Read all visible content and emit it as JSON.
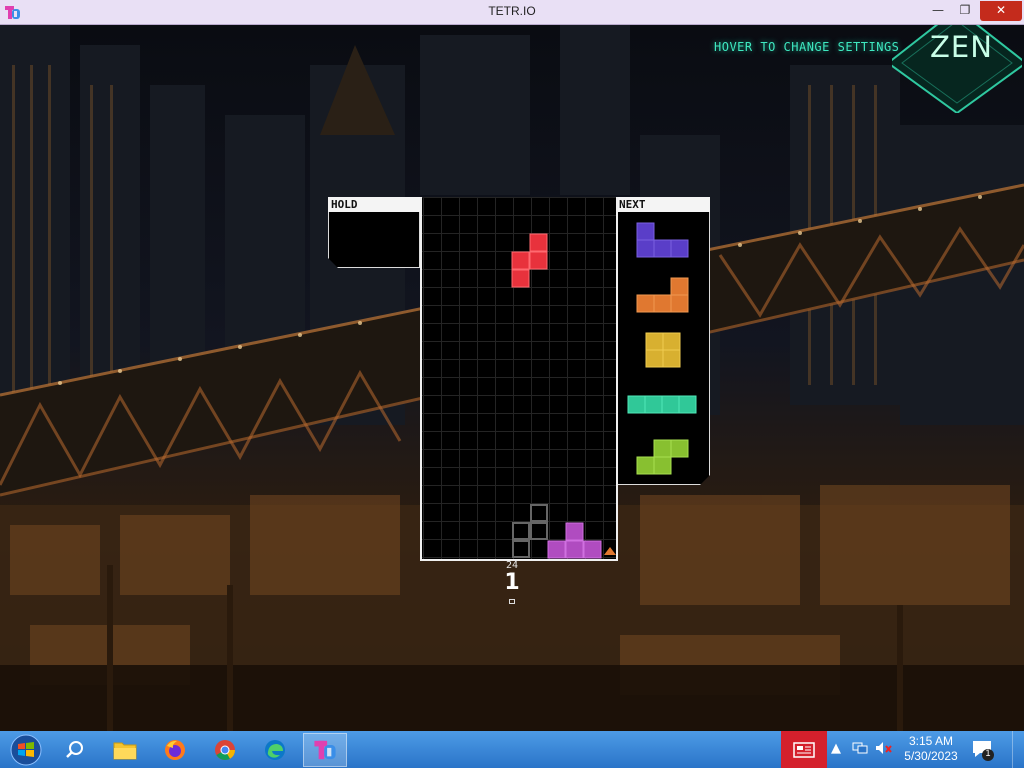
{
  "window": {
    "title": "TETR.IO",
    "controls": {
      "minimize": "—",
      "maximize": "❐",
      "close": "✕"
    }
  },
  "game": {
    "mode": "ZEN",
    "settings_hint": "HOVER TO CHANGE SETTINGS",
    "hold_label": "HOLD",
    "next_label": "NEXT",
    "lines": "24",
    "level": "1",
    "colors": {
      "Z": "#e8323c",
      "T": "#b04cc0",
      "J": "#5a3ec8",
      "L": "#e07830",
      "O": "#d8b030",
      "I": "#30c898",
      "S": "#88c030",
      "ghost": "#555555",
      "accent": "#3fe8c0"
    },
    "next_queue": [
      "J",
      "L",
      "O",
      "I",
      "S"
    ],
    "active_piece": "Z",
    "placed_piece": "T"
  },
  "taskbar": {
    "pinned": [
      "search-icon",
      "file-explorer-icon",
      "firefox-icon",
      "chrome-icon",
      "edge-icon",
      "tetrio-icon"
    ],
    "time": "3:15 AM",
    "date": "5/30/2023",
    "notifications": "1"
  }
}
